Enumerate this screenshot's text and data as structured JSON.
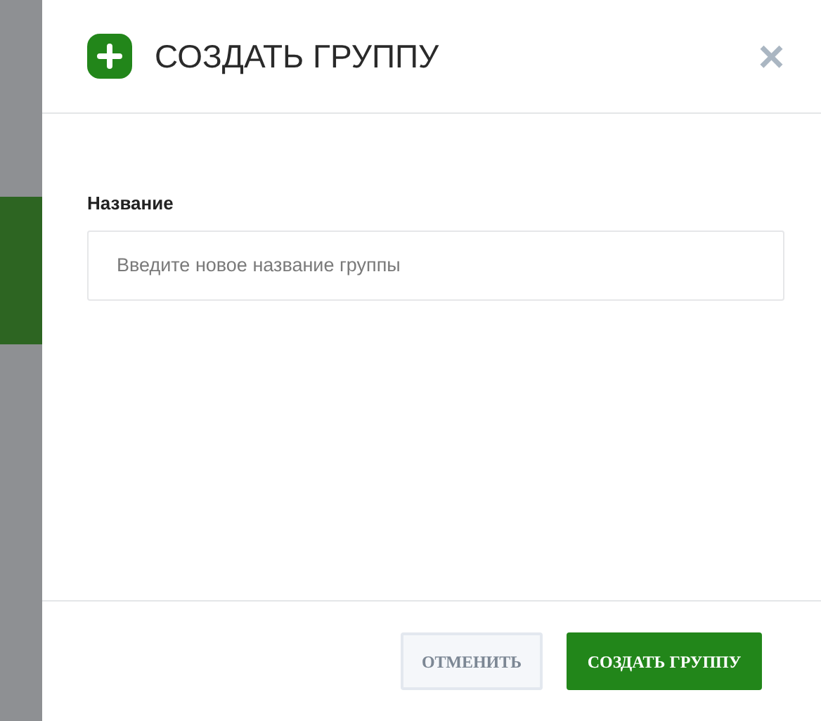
{
  "dialog": {
    "title": "СОЗДАТЬ ГРУППУ",
    "close": "×"
  },
  "field": {
    "label": "Название",
    "placeholder": "Введите новое название группы"
  },
  "buttons": [
    {
      "label": "ОТМЕНИТЬ",
      "kind": "secondary"
    },
    {
      "label": "СОЗДАТЬ ГРУППУ",
      "kind": "primary"
    }
  ]
}
